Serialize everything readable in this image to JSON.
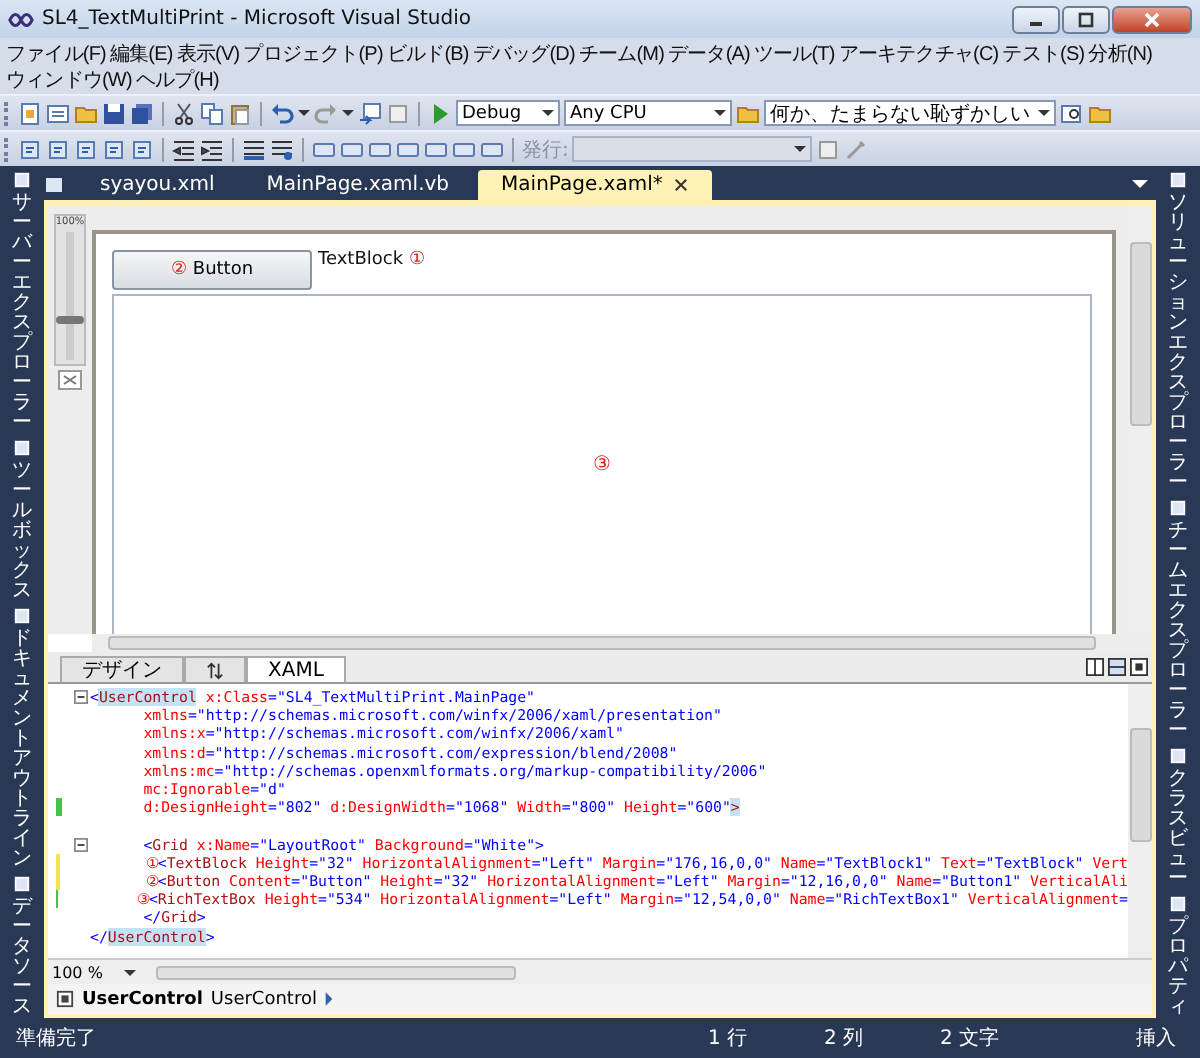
{
  "window": {
    "title": "SL4_TextMultiPrint - Microsoft Visual Studio"
  },
  "menu_rows": [
    [
      "ファイル(F)",
      "編集(E)",
      "表示(V)",
      "プロジェクト(P)",
      "ビルド(B)",
      "デバッグ(D)",
      "チーム(M)",
      "データ(A)",
      "ツール(T)",
      "アーキテクチャ(C)",
      "テスト(S)",
      "分析(N)"
    ],
    [
      "ウィンドウ(W)",
      "ヘルプ(H)"
    ]
  ],
  "toolbar": {
    "configuration": "Debug",
    "platform": "Any CPU",
    "find": "何か、たまらない恥ずかしい",
    "publish_label": "発行:"
  },
  "left_panels": [
    {
      "label": "サーバーエクスプローラー"
    },
    {
      "label": "ツールボックス"
    },
    {
      "label": "ドキュメントアウトライン"
    },
    {
      "label": "データソース"
    }
  ],
  "right_panels": [
    {
      "label": "ソリューションエクスプローラー"
    },
    {
      "label": "チームエクスプローラー"
    },
    {
      "label": "クラスビュー"
    },
    {
      "label": "プロパティ"
    }
  ],
  "doc_tabs": [
    {
      "label": "syayou.xml",
      "selected": false
    },
    {
      "label": "MainPage.xaml.vb",
      "selected": false
    },
    {
      "label": "MainPage.xaml*",
      "selected": true
    }
  ],
  "designer": {
    "zoom": "100%",
    "zoom_slider": {
      "level": 0.35
    },
    "button": {
      "label": "Button",
      "marker": "②"
    },
    "textblock": {
      "text": "TextBlock",
      "marker": "①"
    },
    "richtextbox": {
      "marker": "③"
    }
  },
  "view_tabs": [
    {
      "kind": "design",
      "label": "デザイン",
      "selected": false
    },
    {
      "kind": "swap",
      "selected": false
    },
    {
      "kind": "xaml",
      "label": "XAML",
      "selected": true
    }
  ],
  "code": [
    {
      "fold": true,
      "segs": [
        {
          "kind": "punct",
          "t": "<"
        },
        {
          "kind": "match",
          "t": "UserControl"
        },
        {
          "kind": "attr",
          "t": " x:Class"
        },
        {
          "kind": "value",
          "t": "=\"SL4_TextMultiPrint.MainPage\""
        }
      ]
    },
    {
      "fold": false,
      "segs": [
        {
          "kind": "attr",
          "t": "      xmlns"
        },
        {
          "kind": "value",
          "t": "=\"http://schemas.microsoft.com/winfx/2006/xaml/presentation\""
        }
      ]
    },
    {
      "fold": false,
      "segs": [
        {
          "kind": "attr",
          "t": "      xmlns:x"
        },
        {
          "kind": "value",
          "t": "=\"http://schemas.microsoft.com/winfx/2006/xaml\""
        }
      ]
    },
    {
      "fold": false,
      "segs": [
        {
          "kind": "attr",
          "t": "      xmlns:d"
        },
        {
          "kind": "value",
          "t": "=\"http://schemas.microsoft.com/expression/blend/2008\""
        }
      ]
    },
    {
      "fold": false,
      "segs": [
        {
          "kind": "attr",
          "t": "      xmlns:mc"
        },
        {
          "kind": "value",
          "t": "=\"http://schemas.openxmlformats.org/markup-compatibility/2006\""
        }
      ]
    },
    {
      "fold": false,
      "segs": [
        {
          "kind": "attr",
          "t": "      mc:Ignorable"
        },
        {
          "kind": "value",
          "t": "=\"d\""
        }
      ]
    },
    {
      "fold": false,
      "kind": "saved",
      "segs": [
        {
          "kind": "attr",
          "t": "      d:DesignHeight"
        },
        {
          "kind": "value",
          "t": "=\"802\""
        },
        {
          "kind": "attr",
          "t": " d:DesignWidth"
        },
        {
          "kind": "value",
          "t": "=\"1068\""
        },
        {
          "kind": "attr",
          "t": " Width"
        },
        {
          "kind": "value",
          "t": "=\"800\""
        },
        {
          "kind": "attr",
          "t": " Height"
        },
        {
          "kind": "value",
          "t": "=\"600\""
        },
        {
          "kind": "match",
          "t": ">"
        }
      ]
    },
    {
      "fold": false
    },
    {
      "fold": true,
      "segs": [
        {
          "kind": "punct",
          "t": "      <"
        },
        {
          "kind": "tag",
          "t": "Grid"
        },
        {
          "kind": "attr",
          "t": " x:Name"
        },
        {
          "kind": "value",
          "t": "=\"LayoutRoot\""
        },
        {
          "kind": "attr",
          "t": " Background"
        },
        {
          "kind": "value",
          "t": "=\"White\""
        },
        {
          "kind": "punct",
          "t": ">"
        }
      ]
    },
    {
      "fold": false,
      "kind": "unsaved",
      "segs": [
        {
          "kind": "marker",
          "t": "       ①"
        },
        {
          "kind": "punct",
          "t": "<"
        },
        {
          "kind": "tag",
          "t": "TextBlock"
        },
        {
          "kind": "attr",
          "t": " Height"
        },
        {
          "kind": "value",
          "t": "=\"32\""
        },
        {
          "kind": "attr",
          "t": " HorizontalAlignment"
        },
        {
          "kind": "value",
          "t": "=\"Left\""
        },
        {
          "kind": "attr",
          "t": " Margin"
        },
        {
          "kind": "value",
          "t": "=\"176,16,0,0\""
        },
        {
          "kind": "attr",
          "t": " Name"
        },
        {
          "kind": "value",
          "t": "=\"TextBlock1\""
        },
        {
          "kind": "attr",
          "t": " Text"
        },
        {
          "kind": "value",
          "t": "=\"TextBlock\""
        },
        {
          "kind": "attr",
          "t": " Vert"
        }
      ]
    },
    {
      "fold": false,
      "kind": "unsaved",
      "segs": [
        {
          "kind": "marker",
          "t": "       ②"
        },
        {
          "kind": "punct",
          "t": "<"
        },
        {
          "kind": "tag",
          "t": "Button"
        },
        {
          "kind": "attr",
          "t": " Content"
        },
        {
          "kind": "value",
          "t": "=\"Button\""
        },
        {
          "kind": "attr",
          "t": " Height"
        },
        {
          "kind": "value",
          "t": "=\"32\""
        },
        {
          "kind": "attr",
          "t": " HorizontalAlignment"
        },
        {
          "kind": "value",
          "t": "=\"Left\""
        },
        {
          "kind": "attr",
          "t": " Margin"
        },
        {
          "kind": "value",
          "t": "=\"12,16,0,0\""
        },
        {
          "kind": "attr",
          "t": " Name"
        },
        {
          "kind": "value",
          "t": "=\"Button1\""
        },
        {
          "kind": "attr",
          "t": " VerticalAli"
        }
      ]
    },
    {
      "fold": false,
      "kind": "saved",
      "segs": [
        {
          "kind": "marker",
          "t": "       ③"
        },
        {
          "kind": "punct",
          "t": "<"
        },
        {
          "kind": "tag",
          "t": "RichTextBox"
        },
        {
          "kind": "attr",
          "t": " Height"
        },
        {
          "kind": "value",
          "t": "=\"534\""
        },
        {
          "kind": "attr",
          "t": " HorizontalAlignment"
        },
        {
          "kind": "value",
          "t": "=\"Left\""
        },
        {
          "kind": "attr",
          "t": " Margin"
        },
        {
          "kind": "value",
          "t": "=\"12,54,0,0\""
        },
        {
          "kind": "attr",
          "t": " Name"
        },
        {
          "kind": "value",
          "t": "=\"RichTextBox1\""
        },
        {
          "kind": "attr",
          "t": " VerticalAlignment"
        },
        {
          "kind": "value",
          "t": "="
        }
      ]
    },
    {
      "fold": false,
      "segs": [
        {
          "kind": "punct",
          "t": "      </"
        },
        {
          "kind": "tag",
          "t": "Grid"
        },
        {
          "kind": "punct",
          "t": ">"
        }
      ]
    },
    {
      "fold": false,
      "segs": [
        {
          "kind": "punct",
          "t": "</"
        },
        {
          "kind": "match",
          "t": "UserControl"
        },
        {
          "kind": "punct",
          "t": ">"
        }
      ]
    }
  ],
  "code_zoom": "100 %",
  "breadcrumb": {
    "current": "UserControl",
    "item": "UserControl"
  },
  "status_bar": {
    "message": "準備完了",
    "line": "1 行",
    "column": "2 列",
    "char": "2 文字",
    "mode": "挿入"
  }
}
